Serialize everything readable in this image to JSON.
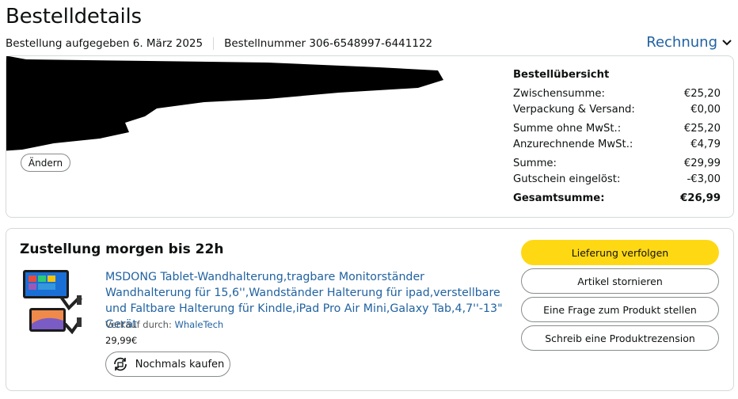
{
  "page": {
    "title": "Bestelldetails"
  },
  "order_meta": {
    "placed": "Bestellung aufgegeben 6. März 2025",
    "number": "Bestellnummer 306-6548997-6441122"
  },
  "invoice": {
    "label": "Rechnung"
  },
  "address": {
    "change_label": "Ändern"
  },
  "summary": {
    "heading": "Bestellübersicht",
    "rows": [
      {
        "label": "Zwischensumme:",
        "value": "€25,20"
      },
      {
        "label": "Verpackung & Versand:",
        "value": "€0,00"
      },
      {
        "label": "Summe ohne MwSt.:",
        "value": "€25,20"
      },
      {
        "label": "Anzurechnende MwSt.:",
        "value": "€4,79"
      },
      {
        "label": "Summe:",
        "value": "€29,99"
      },
      {
        "label": "Gutschein eingelöst:",
        "value": "-€3,00"
      }
    ],
    "total": {
      "label": "Gesamtsumme:",
      "value": "€26,99"
    }
  },
  "delivery": {
    "title": "Zustellung morgen bis 22h",
    "product": {
      "title": "MSDONG Tablet-Wandhalterung,tragbare Monitorständer Wandhalterung für 15,6'',Wandständer Halterung für ipad,verstellbare und Faltbare Halterung für Kindle,iPad Pro Air Mini,Galaxy Tab,4,7''-13\" Gerät",
      "seller_prefix": "Verkauf durch:",
      "seller": "WhaleTech",
      "price": "29,99€",
      "rebuy_label": "Nochmals kaufen"
    },
    "actions": {
      "track": "Lieferung verfolgen",
      "cancel": "Artikel stornieren",
      "question": "Eine Frage zum Produkt stellen",
      "review": "Schreib eine Produktrezension"
    }
  },
  "colors": {
    "link": "#2162a1",
    "primary_button": "#ffd814",
    "border": "#d5d9d9"
  }
}
